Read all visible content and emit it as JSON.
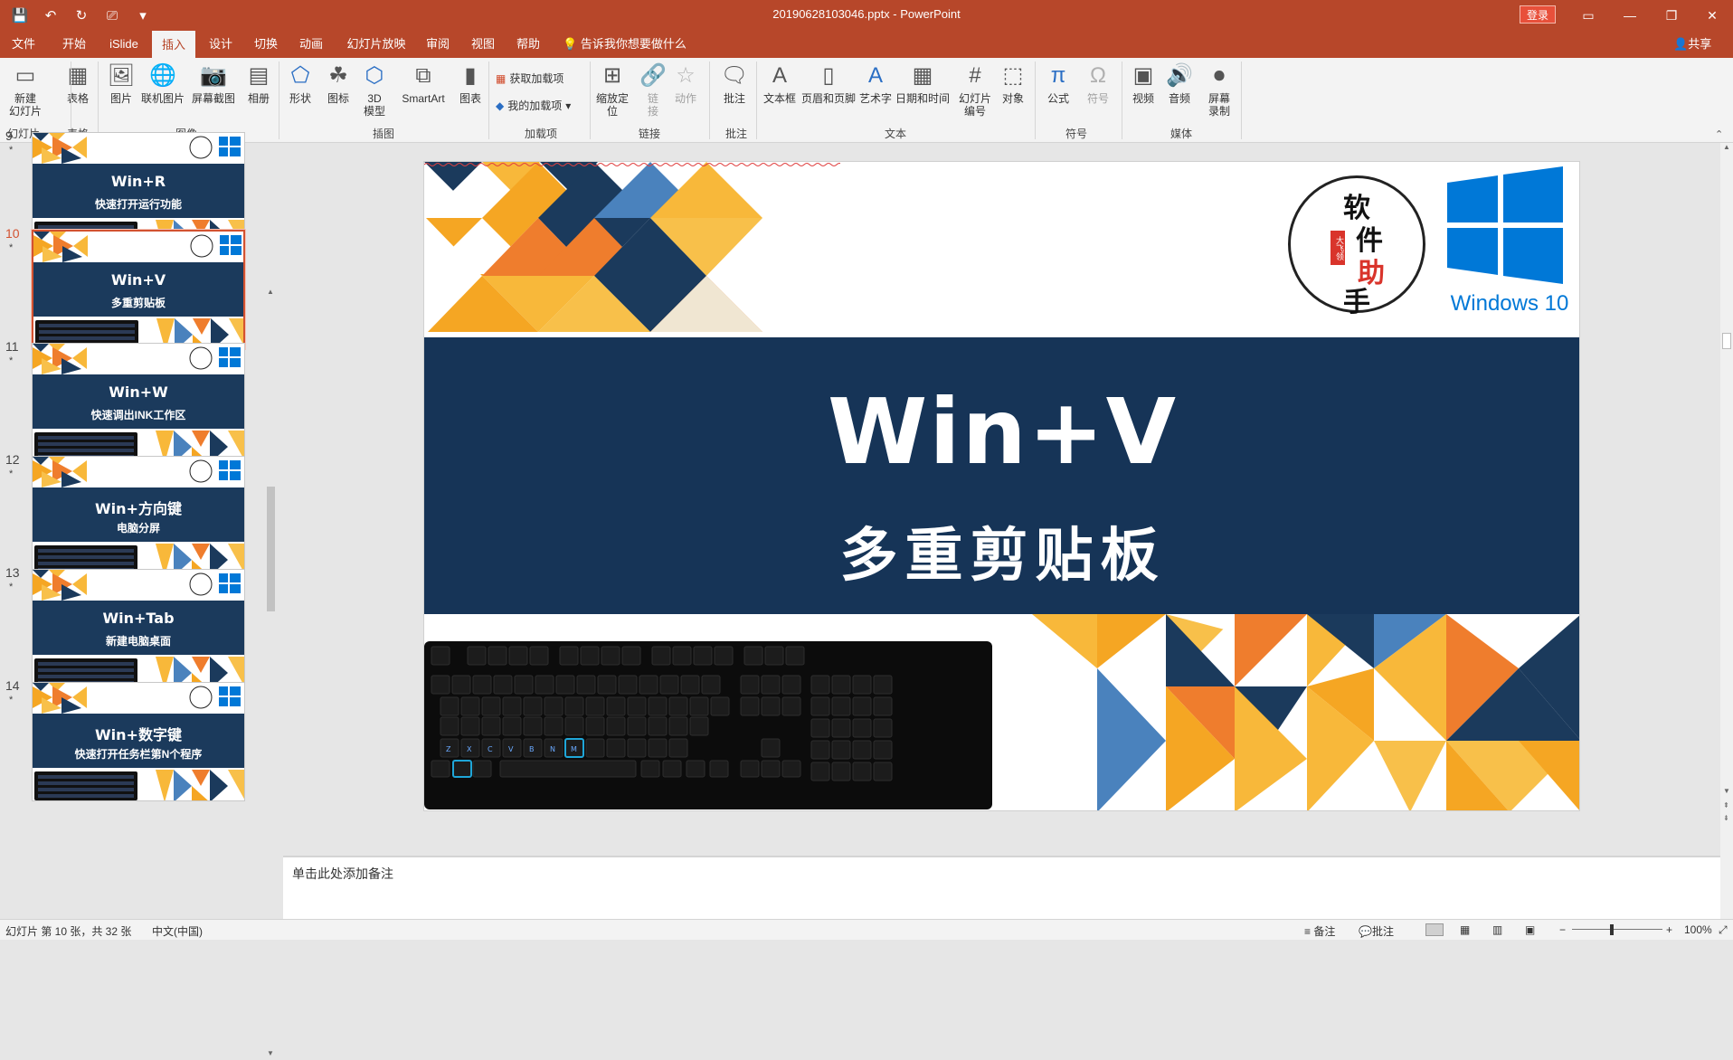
{
  "window": {
    "title": "20190628103046.pptx - PowerPoint",
    "login": "登录"
  },
  "qat": {
    "save": "💾",
    "undo": "↶",
    "redo": "↻",
    "start": "⎚",
    "more": "▾"
  },
  "tabs": [
    "文件",
    "开始",
    "iSlide",
    "插入",
    "设计",
    "切换",
    "动画",
    "幻灯片放映",
    "审阅",
    "视图",
    "帮助"
  ],
  "tell_me": "告诉我你想要做什么",
  "share": "共享",
  "ribbon": {
    "buttons": [
      {
        "label": "新建\n幻灯片",
        "icon": "new-slide-icon"
      },
      {
        "label": "表格",
        "icon": "table-icon"
      },
      {
        "label": "图片",
        "icon": "picture-icon"
      },
      {
        "label": "联机图片",
        "icon": "online-picture-icon"
      },
      {
        "label": "屏幕截图",
        "icon": "screenshot-icon"
      },
      {
        "label": "相册",
        "icon": "album-icon"
      },
      {
        "label": "形状",
        "icon": "shapes-icon"
      },
      {
        "label": "图标",
        "icon": "icons-icon"
      },
      {
        "label": "3D\n模型",
        "icon": "3d-model-icon"
      },
      {
        "label": "SmartArt",
        "icon": "smartart-icon"
      },
      {
        "label": "图表",
        "icon": "chart-icon"
      },
      {
        "label": "缩放定\n位",
        "icon": "zoom-icon"
      },
      {
        "label": "链\n接",
        "icon": "link-icon"
      },
      {
        "label": "动作",
        "icon": "action-icon"
      },
      {
        "label": "批注",
        "icon": "comment-icon"
      },
      {
        "label": "文本框",
        "icon": "textbox-icon"
      },
      {
        "label": "页眉和页脚",
        "icon": "header-footer-icon"
      },
      {
        "label": "艺术字",
        "icon": "wordart-icon"
      },
      {
        "label": "日期和时间",
        "icon": "datetime-icon"
      },
      {
        "label": "幻灯片\n编号",
        "icon": "slide-number-icon"
      },
      {
        "label": "对象",
        "icon": "object-icon"
      },
      {
        "label": "公式",
        "icon": "equation-icon"
      },
      {
        "label": "符号",
        "icon": "symbol-icon"
      },
      {
        "label": "视频",
        "icon": "video-icon"
      },
      {
        "label": "音频",
        "icon": "audio-icon"
      },
      {
        "label": "屏幕\n录制",
        "icon": "screen-record-icon"
      }
    ],
    "addins": {
      "get": "获取加载项",
      "mine": "我的加载项"
    },
    "groups": [
      "幻灯片",
      "表格",
      "图像",
      "插图",
      "加载项",
      "链接",
      "批注",
      "文本",
      "符号",
      "媒体"
    ]
  },
  "slides": [
    {
      "num": "9",
      "title": "Win+R",
      "subtitle": "快速打开运行功能"
    },
    {
      "num": "10",
      "title": "Win+V",
      "subtitle": "多重剪贴板"
    },
    {
      "num": "11",
      "title": "Win+W",
      "subtitle": "快速调出INK工作区"
    },
    {
      "num": "12",
      "title": "Win+方向键",
      "subtitle": "电脑分屏"
    },
    {
      "num": "13",
      "title": "Win+Tab",
      "subtitle": "新建电脑桌面"
    },
    {
      "num": "14",
      "title": "Win+数字键",
      "subtitle": "快速打开任务栏第N个程序"
    }
  ],
  "current_slide": {
    "title": "Win+V",
    "subtitle": "多重剪贴板",
    "logo_text": [
      "软",
      "件",
      "助",
      "手"
    ],
    "logo_stamp": "大飞领",
    "windows_label": "Windows 10"
  },
  "notes_placeholder": "单击此处添加备注",
  "status": {
    "slide_info": "幻灯片 第 10 张，共 32 张",
    "language": "中文(中国)",
    "notes": "备注",
    "comments": "批注",
    "zoom": "100%"
  },
  "colors": {
    "accent": "#b7472a",
    "navy": "#163457",
    "orange": "#ef7d2d",
    "yellow": "#f8b83a",
    "blue": "#4a82bd"
  }
}
